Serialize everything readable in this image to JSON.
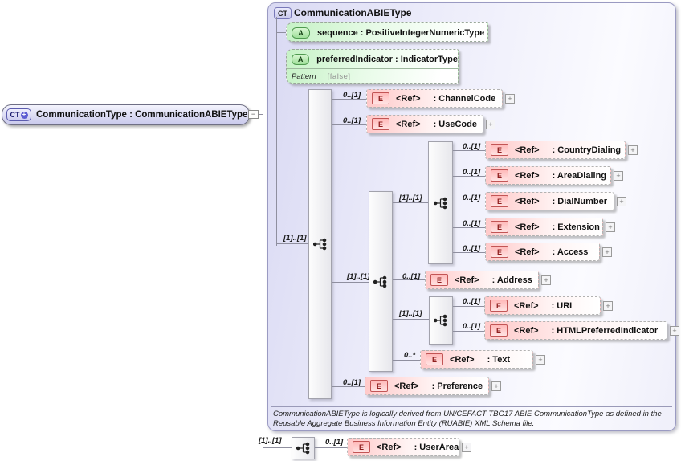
{
  "root": {
    "badge": "CT",
    "plus_icon": "+",
    "label": "CommunicationType : CommunicationABIEType",
    "collapse_icon": "−"
  },
  "panel": {
    "badge": "CT",
    "title": "CommunicationABIEType",
    "attributes": [
      {
        "badge": "A",
        "label": "sequence : PositiveIntegerNumericType"
      },
      {
        "badge": "A",
        "label": "preferredIndicator : IndicatorType",
        "facet_name": "Pattern",
        "facet_value": "[false]"
      }
    ],
    "footnote": "CommunicationABIEType is logically derived from UN/CEFACT TBG17 ABIE CommunicationType as defined in the Reusable Aggregate Business Information Entity (RUABIE) XML Schema file."
  },
  "cardinalities": {
    "main": "[1]..[1]",
    "contact": "[1]..[1]",
    "dial": "[1]..[1]",
    "web": "[1]..[1]",
    "user_area": "[1]..[1]"
  },
  "elements": [
    {
      "badge": "E",
      "cardinality": "0..[1]",
      "ref": "<Ref>",
      "name": ": ChannelCode",
      "expand": "+"
    },
    {
      "badge": "E",
      "cardinality": "0..[1]",
      "ref": "<Ref>",
      "name": ": UseCode",
      "expand": "+"
    },
    {
      "badge": "E",
      "cardinality": "0..[1]",
      "ref": "<Ref>",
      "name": ": CountryDialing",
      "expand": "+"
    },
    {
      "badge": "E",
      "cardinality": "0..[1]",
      "ref": "<Ref>",
      "name": ": AreaDialing",
      "expand": "+"
    },
    {
      "badge": "E",
      "cardinality": "0..[1]",
      "ref": "<Ref>",
      "name": ": DialNumber",
      "expand": "+"
    },
    {
      "badge": "E",
      "cardinality": "0..[1]",
      "ref": "<Ref>",
      "name": ": Extension",
      "expand": "+"
    },
    {
      "badge": "E",
      "cardinality": "0..[1]",
      "ref": "<Ref>",
      "name": ": Access",
      "expand": "+"
    },
    {
      "badge": "E",
      "cardinality": "0..[1]",
      "ref": "<Ref>",
      "name": ": Address",
      "expand": "+"
    },
    {
      "badge": "E",
      "cardinality": "0..[1]",
      "ref": "<Ref>",
      "name": ": URI",
      "expand": "+"
    },
    {
      "badge": "E",
      "cardinality": "0..[1]",
      "ref": "<Ref>",
      "name": ": HTMLPreferredIndicator",
      "expand": "+"
    },
    {
      "badge": "E",
      "cardinality": "0..*",
      "ref": "<Ref>",
      "name": ": Text",
      "expand": "+"
    },
    {
      "badge": "E",
      "cardinality": "0..[1]",
      "ref": "<Ref>",
      "name": ": Preference",
      "expand": "+"
    },
    {
      "badge": "E",
      "cardinality": "0..[1]",
      "ref": "<Ref>",
      "name": ": UserArea",
      "expand": "+"
    }
  ]
}
